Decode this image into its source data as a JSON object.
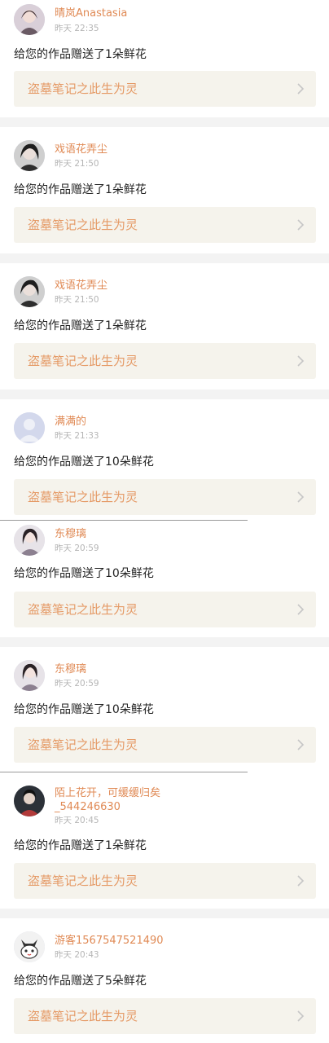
{
  "colors": {
    "username": "#e08a55",
    "time": "#b5b5b5",
    "message": "#222222",
    "work_bg": "#f5f3ec",
    "work_title": "#e59a66",
    "separator": "#f3f3f3"
  },
  "notifications": [
    {
      "username": "晴岚Anastasia",
      "time": "昨天 22:35",
      "message": "给您的作品赠送了1朵鲜花",
      "work": "盗墓笔记之此生为灵",
      "avatar_icon": "girl-avatar-icon"
    },
    {
      "username": "戏语花弄尘",
      "time": "昨天 21:50",
      "message": "给您的作品赠送了1朵鲜花",
      "work": "盗墓笔记之此生为灵",
      "avatar_icon": "girl-avatar-icon"
    },
    {
      "username": "戏语花弄尘",
      "time": "昨天 21:50",
      "message": "给您的作品赠送了1朵鲜花",
      "work": "盗墓笔记之此生为灵",
      "avatar_icon": "girl-avatar-icon"
    },
    {
      "username": "满满的",
      "time": "昨天 21:33",
      "message": "给您的作品赠送了10朵鲜花",
      "work": "盗墓笔记之此生为灵",
      "avatar_icon": "default-user-icon"
    },
    {
      "username": "东穆璃",
      "time": "昨天 20:59",
      "message": "给您的作品赠送了10朵鲜花",
      "work": "盗墓笔记之此生为灵",
      "avatar_icon": "girl-avatar-icon"
    },
    {
      "username": "东穆璃",
      "time": "昨天 20:59",
      "message": "给您的作品赠送了10朵鲜花",
      "work": "盗墓笔记之此生为灵",
      "avatar_icon": "girl-avatar-icon"
    },
    {
      "username": "陌上花开，可缓缓归矣_544246630",
      "time": "昨天 20:45",
      "message": "给您的作品赠送了1朵鲜花",
      "work": "盗墓笔记之此生为灵",
      "avatar_icon": "boy-avatar-icon"
    },
    {
      "username": "游客1567547521490",
      "time": "昨天 20:43",
      "message": "给您的作品赠送了5朵鲜花",
      "work": "盗墓笔记之此生为灵",
      "avatar_icon": "cat-avatar-icon"
    }
  ]
}
